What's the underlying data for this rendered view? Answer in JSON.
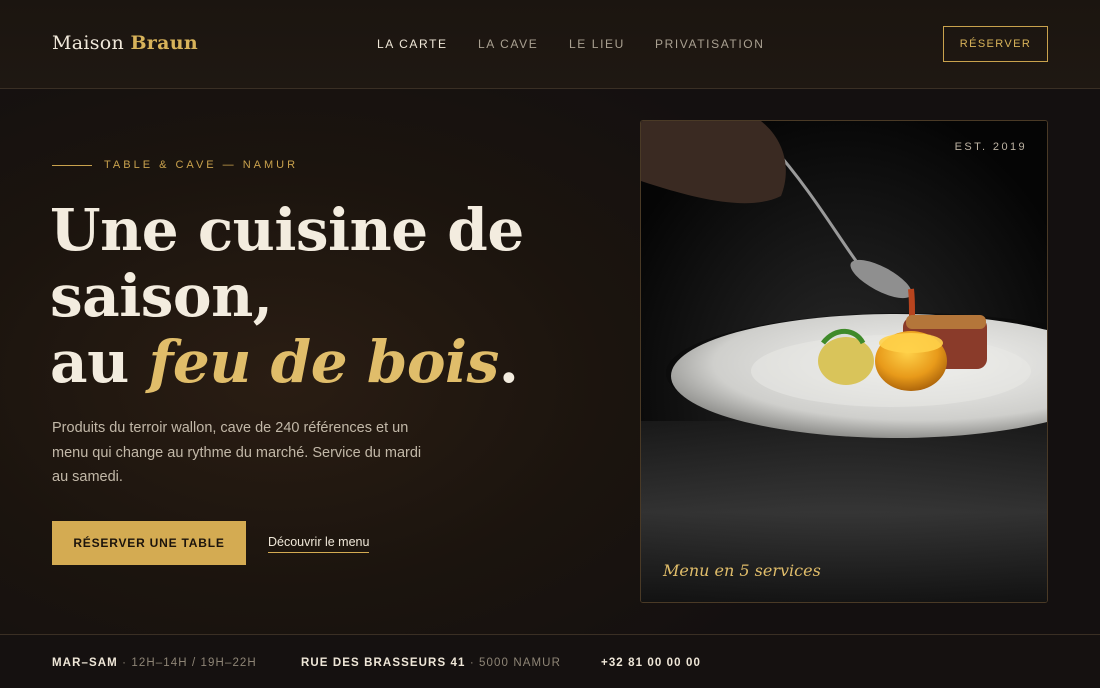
{
  "brand": {
    "name_first": "Maison",
    "name_second": "Braun"
  },
  "nav": {
    "items": [
      {
        "label": "LA CARTE",
        "active": true
      },
      {
        "label": "LA CAVE",
        "active": false
      },
      {
        "label": "LE LIEU",
        "active": false
      },
      {
        "label": "PRIVATISATION",
        "active": false
      }
    ],
    "reserve_label": "RÉSERVER"
  },
  "hero": {
    "eyebrow": "TABLE & CAVE — NAMUR",
    "headline_line1": "Une cuisine de",
    "headline_line2": "saison,",
    "headline_line3_prefix": "au ",
    "headline_line3_accent": "feu de bois",
    "headline_line3_suffix": ".",
    "lede": "Produits du terroir wallon, cave de 240 références et un menu qui change au rythme du marché. Service du mardi au samedi.",
    "cta_label": "RÉSERVER UNE TABLE",
    "link_label": "Découvrir le menu"
  },
  "photo": {
    "badge": "EST. 2019",
    "caption": "Menu en 5 services",
    "icon": "plated-dish-image"
  },
  "footer": {
    "hours_label": "MAR–SAM",
    "hours_value": "12H–14H / 19H–22H",
    "address_label": "RUE DES BRASSEURS 41",
    "address_value": "5000 NAMUR",
    "phone": "+32 81 00 00 00",
    "separator": "·"
  },
  "colors": {
    "accent_gold": "#d4ab52",
    "background": "#1b140e",
    "text_primary": "#efe7d8",
    "text_muted": "#a9a091"
  }
}
